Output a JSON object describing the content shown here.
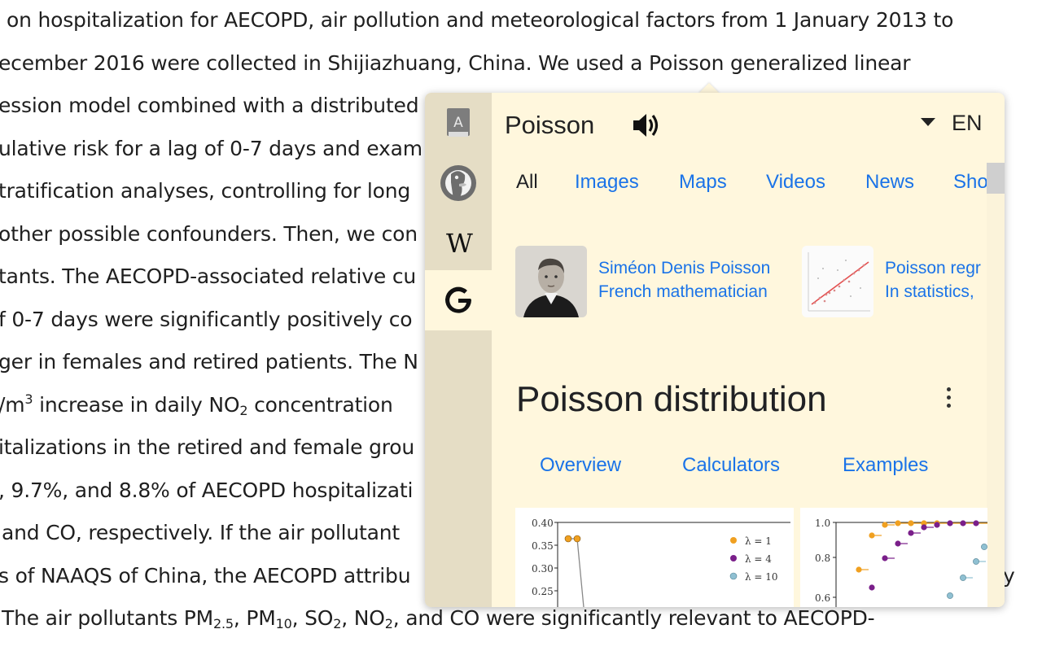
{
  "article": {
    "lines": [
      [
        "on hospitalization for AECOPD, air pollution and meteorological factors from 1 January 2013 to"
      ],
      [
        "ecember 2016 were collected in Shijiazhuang, China. We used a Poisson generalized linear"
      ],
      [
        "ession model combined with a distributed"
      ],
      [
        "ulative risk for a lag of 0-7 days and exam"
      ],
      [
        "tratification analyses, controlling for long"
      ],
      [
        "other possible confounders. Then, we con"
      ],
      [
        "tants. The AECOPD-associated relative cu"
      ],
      [
        "f 0-7 days were significantly positively co"
      ],
      [
        "ger in females and retired patients. The N"
      ],
      [
        "/m",
        "3",
        " increase in daily NO",
        "2",
        " concentration"
      ],
      [
        "italizations in the retired and female grou"
      ],
      [
        ", 9.7%, and 8.8% of AECOPD hospitalizati"
      ],
      [
        " and CO, respectively. If the air pollutant"
      ],
      [
        "s of NAAQS of China, the AECOPD attribu"
      ],
      [
        " The air pollutants PM",
        "2.5",
        ", PM",
        "10",
        ", SO",
        "2",
        ", NO",
        "2",
        ", and CO were significantly relevant to AECOPD-"
      ]
    ],
    "right_edge_text": "y"
  },
  "popup": {
    "sidebar": [
      {
        "name": "dictionary",
        "glyph": "A"
      },
      {
        "name": "duckduckgo",
        "glyph": ""
      },
      {
        "name": "wikipedia",
        "glyph": "W"
      },
      {
        "name": "google",
        "glyph": "G"
      }
    ],
    "word": "Poisson",
    "language": "EN",
    "tabs": [
      "All",
      "Images",
      "Maps",
      "Videos",
      "News",
      "Sho"
    ],
    "results": [
      {
        "title": "Siméon Denis Poisson",
        "subtitle": "French mathematician"
      },
      {
        "title": "Poisson regr",
        "subtitle": "In statistics,"
      }
    ],
    "knowledge_panel": {
      "title": "Poisson distribution",
      "tabs": [
        "Overview",
        "Calculators",
        "Examples"
      ]
    },
    "plot_left": {
      "yticks": [
        "0.40",
        "0.35",
        "0.30",
        "0.25"
      ],
      "legend": [
        "λ = 1",
        "λ = 4",
        "λ = 10"
      ]
    },
    "plot_right": {
      "yticks": [
        "1.0",
        "0.8",
        "0.6"
      ]
    },
    "colors": {
      "link": "#1a73e8",
      "popup_bg": "#fff7dd",
      "sidebar_bg": "#e5ddc5",
      "series_1": "#f0a020",
      "series_2": "#7a1f8a",
      "series_3": "#8fc0d2"
    }
  }
}
